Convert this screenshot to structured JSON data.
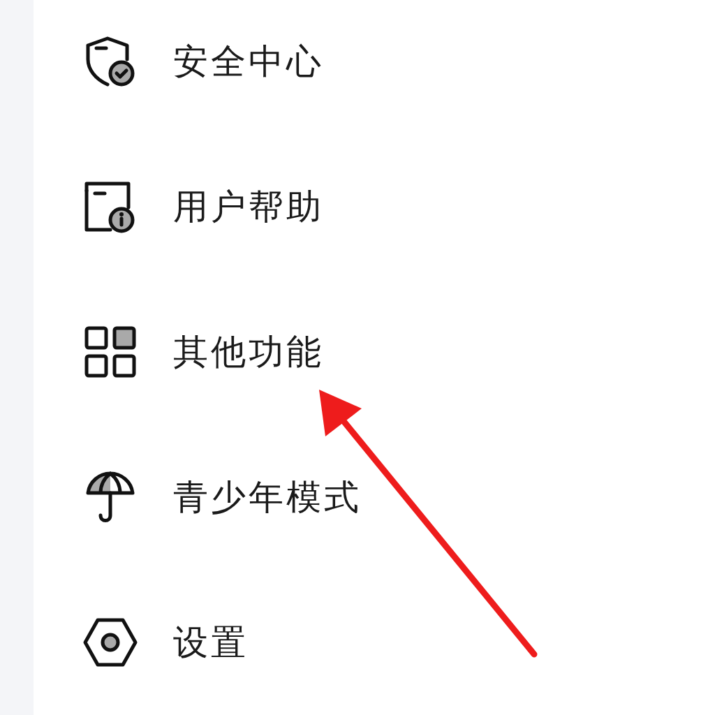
{
  "menu": {
    "items": [
      {
        "label": "安全中心",
        "kind": "shield"
      },
      {
        "label": "用户帮助",
        "kind": "help"
      },
      {
        "label": "其他功能",
        "kind": "grid"
      },
      {
        "label": "青少年模式",
        "kind": "umbrella"
      },
      {
        "label": "设置",
        "kind": "settings"
      }
    ]
  }
}
